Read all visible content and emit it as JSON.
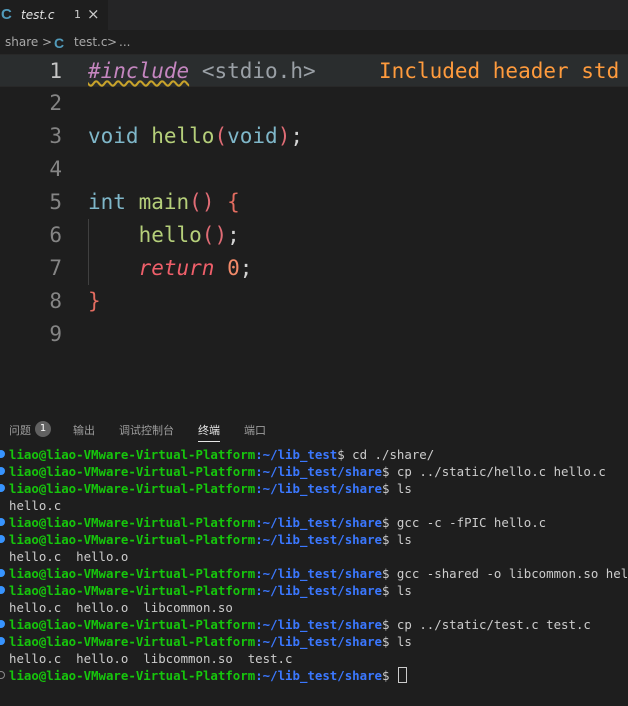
{
  "tab": {
    "icon": "C",
    "filename": "test.c",
    "problem_count": "1",
    "close_glyph": "×"
  },
  "breadcrumb": {
    "folder": "share",
    "sep1": ">",
    "icon": "C",
    "file": "test.c",
    "sep2": ">",
    "more": "..."
  },
  "editor": {
    "line_numbers": [
      "1",
      "2",
      "3",
      "4",
      "5",
      "6",
      "7",
      "8",
      "9"
    ],
    "line1": {
      "include": "#include",
      "header": "<stdio.h>",
      "hint": "Included header std"
    },
    "line3": {
      "type": "void",
      "fn": "hello",
      "lparen": "(",
      "param": "void",
      "rparen": ")",
      "semi": ";"
    },
    "line5": {
      "type": "int",
      "fn": "main",
      "parens": "()",
      "brace": "{"
    },
    "line6": {
      "fn": "hello",
      "parens": "()",
      "semi": ";"
    },
    "line7": {
      "keyword": "return",
      "value": "0",
      "semi": ";"
    },
    "line8": {
      "brace": "}"
    }
  },
  "panel": {
    "tabs": [
      "问题",
      "输出",
      "调试控制台",
      "终端",
      "端口"
    ],
    "problems_badge": "1",
    "active_tab": "终端"
  },
  "terminal": {
    "lines": [
      {
        "type": "prompt",
        "user": "liao@liao-VMware-Virtual-Platform",
        "path": ":~/lib_test",
        "cmd": "$ cd ./share/"
      },
      {
        "type": "prompt",
        "user": "liao@liao-VMware-Virtual-Platform",
        "path": ":~/lib_test/share",
        "cmd": "$ cp ../static/hello.c hello.c"
      },
      {
        "type": "prompt",
        "user": "liao@liao-VMware-Virtual-Platform",
        "path": ":~/lib_test/share",
        "cmd": "$ ls"
      },
      {
        "type": "output",
        "text": "hello.c"
      },
      {
        "type": "prompt",
        "user": "liao@liao-VMware-Virtual-Platform",
        "path": ":~/lib_test/share",
        "cmd": "$ gcc -c -fPIC hello.c"
      },
      {
        "type": "prompt",
        "user": "liao@liao-VMware-Virtual-Platform",
        "path": ":~/lib_test/share",
        "cmd": "$ ls"
      },
      {
        "type": "output",
        "text": "hello.c  hello.o"
      },
      {
        "type": "prompt",
        "user": "liao@liao-VMware-Virtual-Platform",
        "path": ":~/lib_test/share",
        "cmd": "$ gcc -shared -o libcommon.so hello.o"
      },
      {
        "type": "prompt",
        "user": "liao@liao-VMware-Virtual-Platform",
        "path": ":~/lib_test/share",
        "cmd": "$ ls"
      },
      {
        "type": "output",
        "text": "hello.c  hello.o  libcommon.so"
      },
      {
        "type": "prompt",
        "user": "liao@liao-VMware-Virtual-Platform",
        "path": ":~/lib_test/share",
        "cmd": "$ cp ../static/test.c test.c"
      },
      {
        "type": "prompt",
        "user": "liao@liao-VMware-Virtual-Platform",
        "path": ":~/lib_test/share",
        "cmd": "$ ls"
      },
      {
        "type": "output",
        "text": "hello.c  hello.o  libcommon.so  test.c"
      },
      {
        "type": "current",
        "user": "liao@liao-VMware-Virtual-Platform",
        "path": ":~/lib_test/share",
        "cmd": "$ "
      }
    ]
  },
  "colors": {
    "accent": "#3794ff",
    "user": "#16c60c",
    "path": "#3b78ff"
  }
}
